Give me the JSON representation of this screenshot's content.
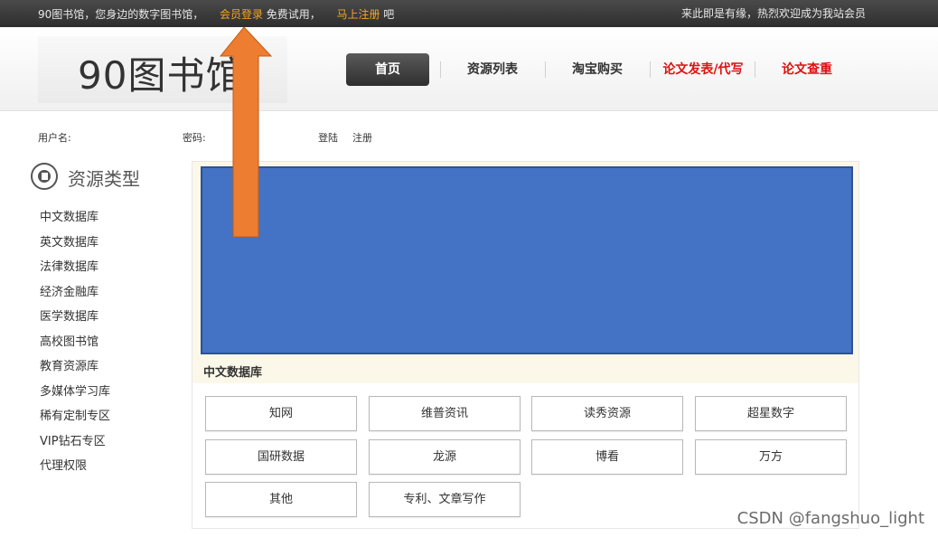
{
  "topbar": {
    "intro": "90图书馆，您身边的数字图书馆，",
    "login_link": "会员登录",
    "trial": "免费试用，",
    "register_link": "马上注册",
    "suffix": "吧",
    "welcome": "来此即是有缘，热烈欢迎成为我站会员"
  },
  "header": {
    "logo": "90图书馆",
    "nav": [
      "首页",
      "资源列表",
      "淘宝购买",
      "论文发表/代写",
      "论文查重"
    ]
  },
  "login": {
    "username_label": "用户名:",
    "password_label": "密码:",
    "login_label": "登陆",
    "register_label": "注册"
  },
  "sidebar": {
    "title": "资源类型",
    "items": [
      "中文数据库",
      "英文数据库",
      "法律数据库",
      "经济金融库",
      "医学数据库",
      "高校图书馆",
      "教育资源库",
      "多媒体学习库",
      "稀有定制专区",
      "VIP钻石专区",
      "代理权限"
    ]
  },
  "main": {
    "category_title": "中文数据库",
    "buttons": [
      "知网",
      "维普资讯",
      "读秀资源",
      "超星数字",
      "国研数据",
      "龙源",
      "博看",
      "万方",
      "其他",
      "专利、文章写作"
    ]
  },
  "watermark": "CSDN @fangshuo_light",
  "colors": {
    "accent_orange": "#f5a623",
    "nav_red": "#e01010",
    "banner_blue": "#4472c4",
    "arrow_orange": "#ed7d31"
  }
}
